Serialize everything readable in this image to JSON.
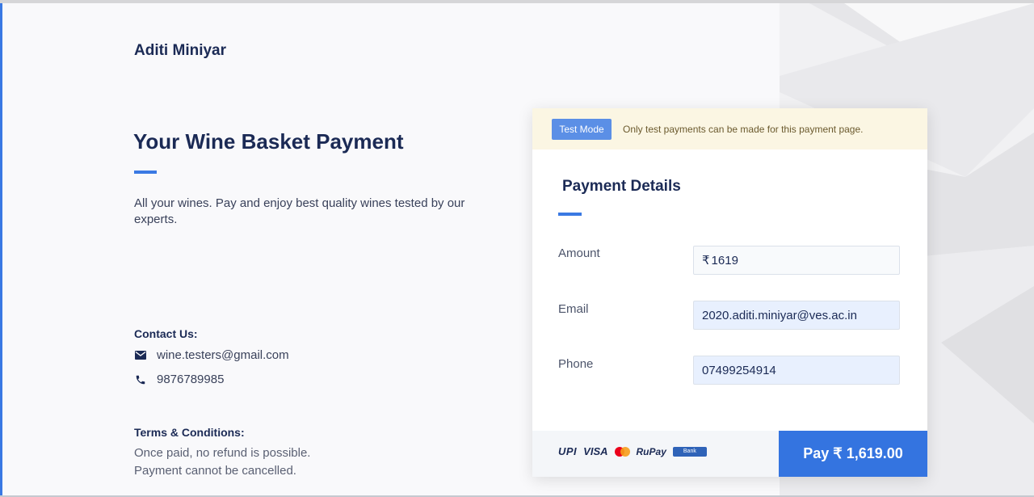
{
  "merchant": {
    "name": "Aditi Miniyar"
  },
  "page": {
    "title": "Your Wine Basket Payment",
    "description": "All your wines. Pay and enjoy best quality wines tested by our experts."
  },
  "contact": {
    "heading": "Contact Us:",
    "email": "wine.testers@gmail.com",
    "phone": "9876789985",
    "email_icon": "mail-icon",
    "phone_icon": "phone-icon"
  },
  "terms": {
    "heading": "Terms & Conditions:",
    "lines": [
      "Once paid,  no refund is possible.",
      "Payment cannot be cancelled."
    ]
  },
  "test_mode": {
    "badge": "Test Mode",
    "note": "Only test payments can be made for this payment page."
  },
  "payment_details": {
    "title": "Payment Details",
    "fields": [
      {
        "label": "Amount",
        "currency": "₹",
        "value": "1619"
      },
      {
        "label": "Email",
        "value": "2020.aditi.miniyar@ves.ac.in"
      },
      {
        "label": "Phone",
        "value": "07499254914"
      }
    ]
  },
  "payment_logos": {
    "upi": "UPI",
    "visa": "VISA",
    "rupay": "RuPay",
    "bank": "Bank"
  },
  "pay_button": {
    "label": "Pay ₹ 1,619.00"
  },
  "colors": {
    "accent": "#3a79e3",
    "pay_button": "#3474e0",
    "test_badge": "#5b8fe6",
    "test_banner_bg": "#fbf6e3",
    "text_dark": "#1b2a55"
  }
}
